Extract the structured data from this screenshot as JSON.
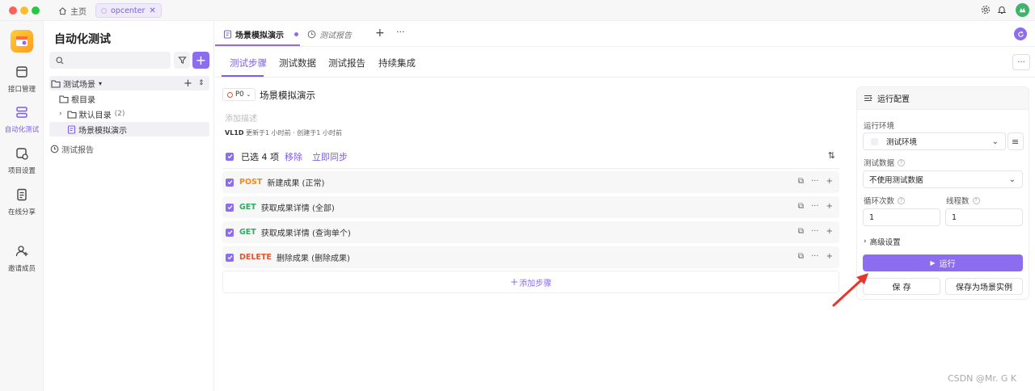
{
  "window": {
    "home_tab": "主页",
    "project_tab": "opcenter",
    "traffic_lights": [
      "#ff5f57",
      "#febc2e",
      "#28c840"
    ]
  },
  "sidebar_nav": {
    "items": [
      {
        "label": "接口管理",
        "icon": "api-icon"
      },
      {
        "label": "自动化测试",
        "icon": "automation-icon",
        "active": true
      },
      {
        "label": "项目设置",
        "icon": "settings-icon"
      },
      {
        "label": "在线分享",
        "icon": "share-icon"
      },
      {
        "label": "邀请成员",
        "icon": "invite-icon"
      }
    ]
  },
  "tree": {
    "title": "自动化测试",
    "search_placeholder": "",
    "scenario_group": "测试场景",
    "root": "根目录",
    "default_folder": "默认目录",
    "default_count": "(2)",
    "scene_item": "场景模拟演示",
    "reports": "测试报告"
  },
  "doc_tabs": {
    "active_tab": "场景模拟演示",
    "second_tab": "测试报告"
  },
  "sub_tabs": [
    "测试步骤",
    "测试数据",
    "测试报告",
    "持续集成"
  ],
  "scene": {
    "priority": "P0",
    "name": "场景模拟演示",
    "description_placeholder": "添加描述",
    "author": "VL1D",
    "meta_text": "更新于1 小时前 · 创建于1 小时前"
  },
  "selection": {
    "selected_text": "已选 4 项",
    "remove_label": "移除",
    "sync_label": "立即同步"
  },
  "steps": [
    {
      "method": "POST",
      "color": "#f5871f",
      "name": "新建成果 (正常)"
    },
    {
      "method": "GET",
      "color": "#27ae60",
      "name": "获取成果详情 (全部)"
    },
    {
      "method": "GET",
      "color": "#27ae60",
      "name": "获取成果详情 (查询单个)"
    },
    {
      "method": "DELETE",
      "color": "#e8532b",
      "name": "删除成果 (删除成果)"
    }
  ],
  "add_step_label": "添加步骤",
  "run_config": {
    "title": "运行配置",
    "env_label": "运行环境",
    "env_value": "测试环境",
    "data_label": "测试数据",
    "data_value": "不使用测试数据",
    "loop_label": "循环次数",
    "loop_value": "1",
    "threads_label": "线程数",
    "threads_value": "1",
    "advanced_label": "高级设置",
    "run_label": "运行",
    "save_label": "保 存",
    "save_as_label": "保存为场景实例"
  },
  "watermark": "CSDN @Mr. G K",
  "colors": {
    "accent": "#8c6df0",
    "annotation_arrow": "#e8352b"
  }
}
